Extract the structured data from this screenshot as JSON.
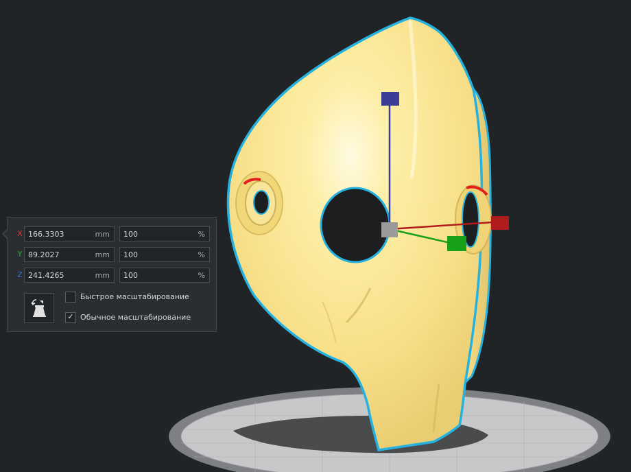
{
  "scale_panel": {
    "axes": [
      {
        "label": "X",
        "color": "#e3342f",
        "size_value": "166.3303",
        "size_unit": "mm",
        "percent_value": "100",
        "percent_unit": "%"
      },
      {
        "label": "Y",
        "color": "#1fb43a",
        "size_value": "89.2027",
        "size_unit": "mm",
        "percent_value": "100",
        "percent_unit": "%"
      },
      {
        "label": "Z",
        "color": "#3e6fe0",
        "size_value": "241.4265",
        "size_unit": "mm",
        "percent_value": "100",
        "percent_unit": "%"
      }
    ],
    "reset_icon": "reset-scale-icon",
    "options": [
      {
        "label": "Быстрое масштабирование",
        "checked": false
      },
      {
        "label": "Обычное масштабирование",
        "checked": true,
        "mark": "✓"
      }
    ]
  },
  "scene": {
    "model_color": "#fce793",
    "selection_outline_color": "#26b2e0",
    "gizmo_colors": {
      "x": "#b01c1c",
      "y": "#19a019",
      "z": "#3a3f95",
      "center": "#9a9a9a"
    }
  }
}
